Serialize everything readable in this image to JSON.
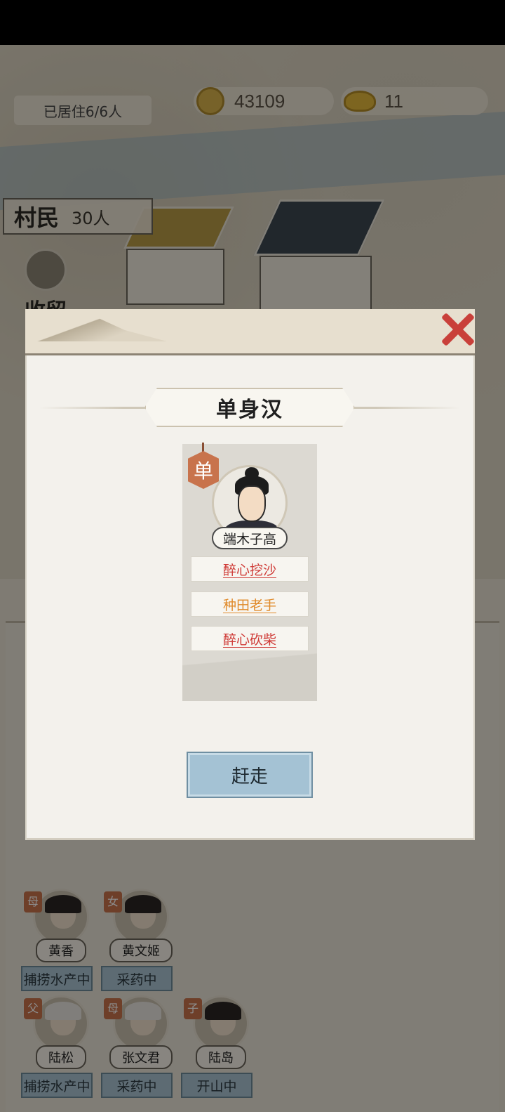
{
  "hud": {
    "residents": "已居住6/6人",
    "coins": "43109",
    "ingots": "11",
    "villagers_label": "村民",
    "villagers_count": "30人",
    "shelter_label": "收留"
  },
  "family": [
    {
      "relation": "母",
      "name": "黄香",
      "job": "捕捞水产中",
      "old": false
    },
    {
      "relation": "女",
      "name": "黄文姬",
      "job": "采药中",
      "old": false
    },
    {
      "relation": "父",
      "name": "陆松",
      "job": "捕捞水产中",
      "old": true
    },
    {
      "relation": "母",
      "name": "张文君",
      "job": "采药中",
      "old": true
    },
    {
      "relation": "子",
      "name": "陆岛",
      "job": "开山中",
      "old": false
    }
  ],
  "modal": {
    "title": "单身汉",
    "single_tag": "单",
    "character_name": "端木子高",
    "traits": [
      {
        "label": "醉心挖沙",
        "color": "#cf3a36"
      },
      {
        "label": "种田老手",
        "color": "#e08a2a"
      },
      {
        "label": "醉心砍柴",
        "color": "#cf3a36"
      }
    ],
    "action_button": "赶走"
  }
}
